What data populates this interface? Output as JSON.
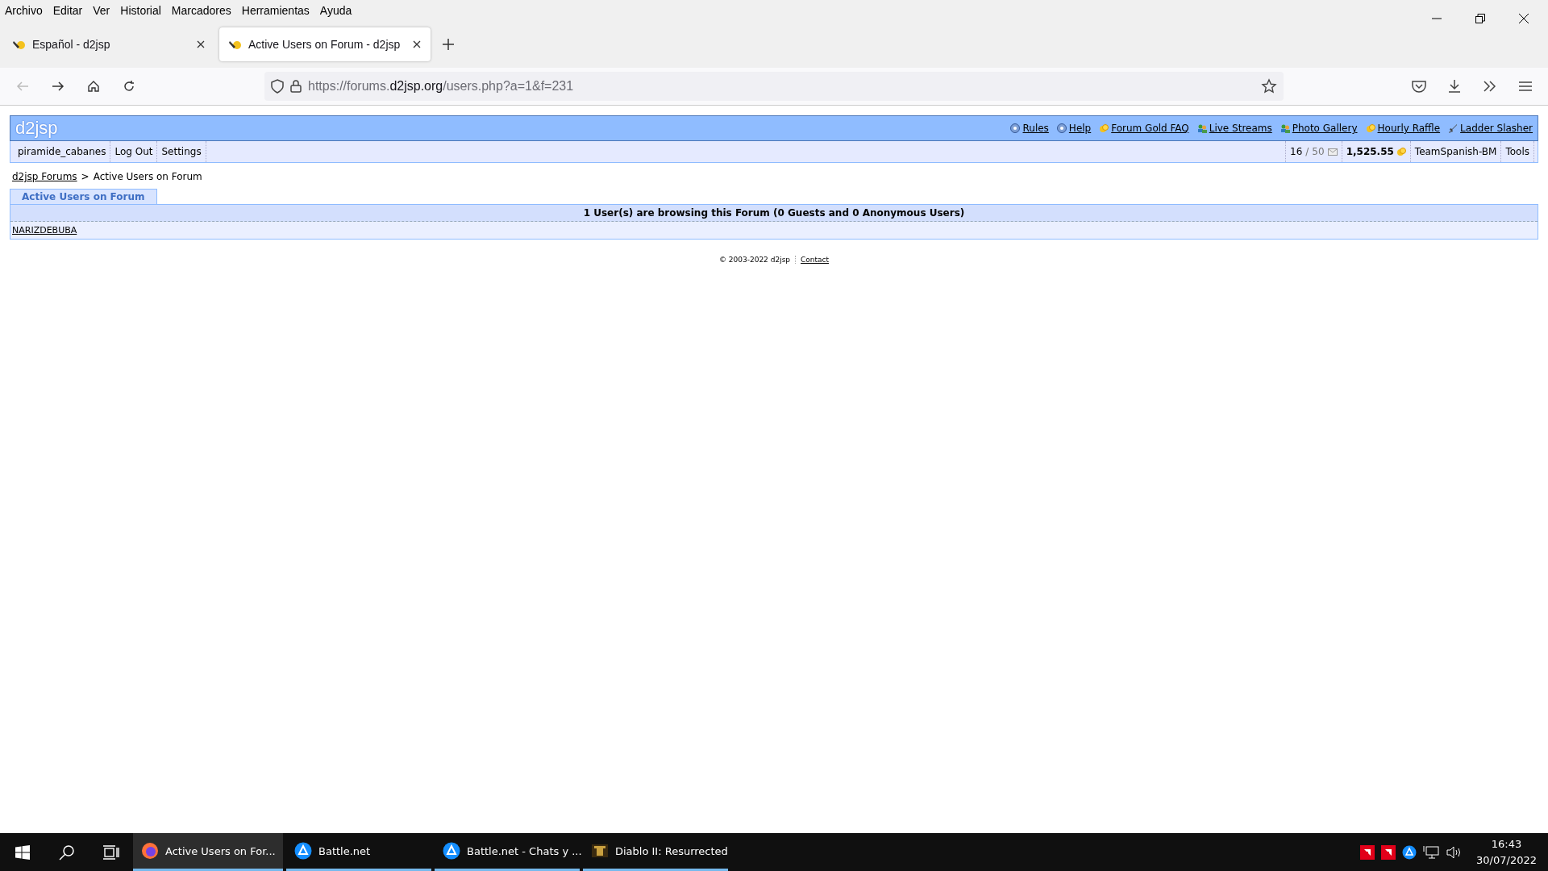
{
  "menu": [
    "Archivo",
    "Editar",
    "Ver",
    "Historial",
    "Marcadores",
    "Herramientas",
    "Ayuda"
  ],
  "tabs": [
    {
      "title": "Español - d2jsp",
      "selected": false
    },
    {
      "title": "Active Users on Forum - d2jsp",
      "selected": true
    }
  ],
  "url": {
    "prefix": "https://forums.",
    "domain": "d2jsp.org",
    "path": "/users.php?a=1&f=231"
  },
  "site": {
    "logo": "d2jsp",
    "links": [
      {
        "label": "Rules",
        "kind": "help"
      },
      {
        "label": "Help",
        "kind": "help"
      },
      {
        "label": "Forum Gold FAQ",
        "kind": "gold"
      },
      {
        "label": "Live Streams",
        "kind": "people"
      },
      {
        "label": "Photo Gallery",
        "kind": "people"
      },
      {
        "label": "Hourly Raffle",
        "kind": "gold"
      },
      {
        "label": "Ladder Slasher",
        "kind": "sword"
      }
    ],
    "user_menu": [
      "piramide_cabanes",
      "Log Out",
      "Settings"
    ],
    "messages": {
      "unread": "16",
      "separator": "/",
      "total": "50"
    },
    "gold": "1,525.55",
    "right_menu": [
      "TeamSpanish-BM",
      "Tools"
    ]
  },
  "breadcrumb": {
    "link": "d2jsp Forums",
    "separator": ">",
    "current": "Active Users on Forum"
  },
  "panel": {
    "tab": "Active Users on Forum",
    "heading": "1 User(s) are browsing this Forum (0 Guests and 0 Anonymous Users)",
    "users": [
      "NARIZDEBUBA"
    ]
  },
  "footer": {
    "copyright": "© 2003-2022 d2jsp",
    "link": "Contact"
  },
  "taskbar": {
    "apps": [
      {
        "label": "Active Users on For...",
        "kind": "browser",
        "selected": true
      },
      {
        "label": "Battle.net",
        "kind": "launcher",
        "selected": false
      },
      {
        "label": "Battle.net - Chats y ...",
        "kind": "launcher",
        "selected": false
      },
      {
        "label": "Diablo II: Resurrected",
        "kind": "game",
        "selected": false
      }
    ],
    "time": "16:43",
    "date": "30/07/2022"
  }
}
